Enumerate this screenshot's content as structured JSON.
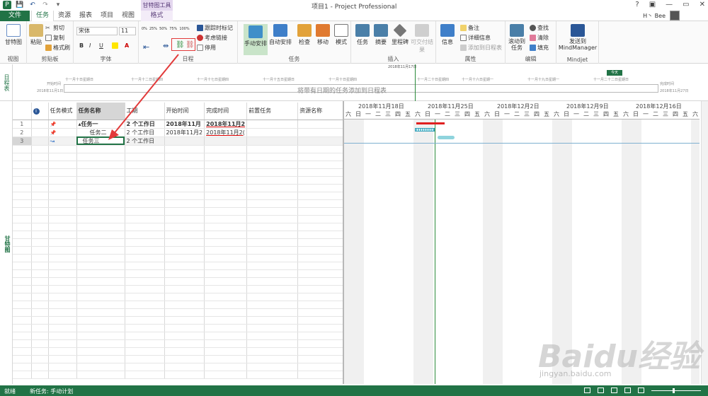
{
  "titlebar": {
    "title": "项目1 - Project Professional",
    "context_tab_title": "甘特图工具",
    "help": "?",
    "user": "H丶 Bee",
    "min": "—",
    "restore": "▭",
    "close": "✕"
  },
  "tabs": [
    "文件",
    "任务",
    "资源",
    "报表",
    "项目",
    "视图",
    "格式"
  ],
  "ribbon": {
    "view": {
      "gantt_label": "甘特图",
      "group": "视图"
    },
    "clipboard": {
      "paste": "粘贴",
      "cut": "剪切",
      "copy": "复制",
      "format_painter": "格式刷",
      "group": "剪贴板"
    },
    "font": {
      "font_name": "宋体",
      "font_size": "11",
      "bold": "B",
      "italic": "I",
      "underline": "U",
      "group": "字体"
    },
    "schedule": {
      "pct": [
        "0%",
        "25%",
        "50%",
        "75%",
        "100%"
      ],
      "mark_on_track": "跟踪时标记",
      "respect_links": "考虑链接",
      "inactivate": "停用",
      "group": "日程"
    },
    "tasks": {
      "manual": "手动安排",
      "auto": "自动安排",
      "inspect": "检查",
      "move": "移动",
      "mode": "模式",
      "group": "任务"
    },
    "insert": {
      "task": "任务",
      "summary": "摘要",
      "milestone": "里程碑",
      "deliverable": "可交付结果",
      "group": "插入"
    },
    "properties": {
      "info": "信息",
      "notes": "备注",
      "details": "详细信息",
      "add_timeline": "添加到日程表",
      "group": "属性"
    },
    "editing": {
      "scroll": "滚动到任务",
      "find": "查找",
      "clear": "清除",
      "fill": "填充",
      "group": "编辑"
    },
    "mindjet": {
      "send": "发送到 MindManager",
      "group": "Mindjet"
    }
  },
  "timeline": {
    "side_label": "日程表",
    "start_label": "开始时间",
    "start_date": "2018年11月1日",
    "current_date": "2018年11月17日",
    "placeholder": "将带有日期的任务添加到日程表",
    "today": "今天",
    "finish_label": "完成时间",
    "finish_date": "2018年11月27日",
    "ticks": [
      "十一月十日星期日",
      "十一月十二日星期四",
      "十一月十七日星期四",
      "十一月十五日星期日",
      "十一月十日星期四",
      "十一月十六日星期一",
      "十一月十九日星期一",
      "十一月二十二日星期日",
      "十一月二十日星期四"
    ]
  },
  "sheet": {
    "side_label": "甘特图",
    "columns": [
      "",
      "i",
      "任务模式",
      "任务名称",
      "工期",
      "开始时间",
      "完成时间",
      "前置任务",
      "资源名称"
    ],
    "rows": [
      {
        "id": "1",
        "mode": "📌",
        "name": "▴任务一",
        "duration": "2 个工作日",
        "start": "2018年11月",
        "finish": "2018年11月2"
      },
      {
        "id": "2",
        "mode": "📌",
        "name": "任务二",
        "duration": "2 个工作日",
        "start": "2018年11月2",
        "finish": "2018年11月2("
      },
      {
        "id": "3",
        "mode": "↝",
        "name": "任务三",
        "duration": "2 个工作日",
        "start": "",
        "finish": ""
      }
    ]
  },
  "gantt": {
    "weeks": [
      "2018年11月18日",
      "2018年11月25日",
      "2018年12月2日",
      "2018年12月9日",
      "2018年12月16日"
    ],
    "days": [
      "六",
      "日",
      "一",
      "二",
      "三",
      "四",
      "五"
    ]
  },
  "status": {
    "ready": "就绪",
    "new_task": "新任务: 手动计划"
  },
  "watermark": {
    "brand": "Baidu经验",
    "url": "jingyan.baidu.com"
  }
}
